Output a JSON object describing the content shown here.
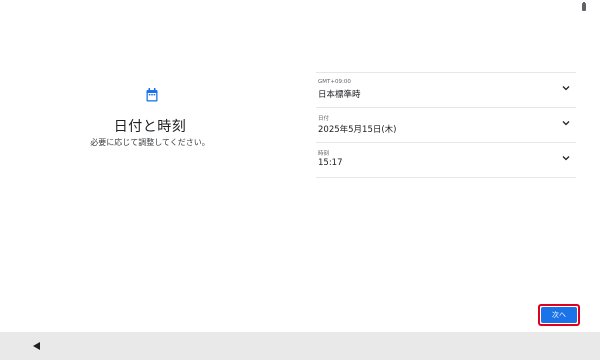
{
  "status_bar": {
    "battery_icon": "battery-icon"
  },
  "left_panel": {
    "icon": "calendar-icon",
    "title": "日付と時刻",
    "subtitle": "必要に応じて調整してください。"
  },
  "settings": [
    {
      "label": "GMT+09:00",
      "value": "日本標準時",
      "icon": "chevron-down-icon"
    },
    {
      "label": "日付",
      "value": "2025年5月15日(木)",
      "icon": "chevron-down-icon"
    },
    {
      "label": "時刻",
      "value": "15:17",
      "icon": "chevron-down-icon"
    }
  ],
  "footer": {
    "next_label": "次へ",
    "highlight_color": "#e0001b",
    "button_color": "#1a73e8"
  },
  "nav_bar": {
    "back_icon": "back-triangle-icon"
  },
  "colors": {
    "accent": "#1a73e8",
    "nav_background": "#e9e9e9"
  }
}
